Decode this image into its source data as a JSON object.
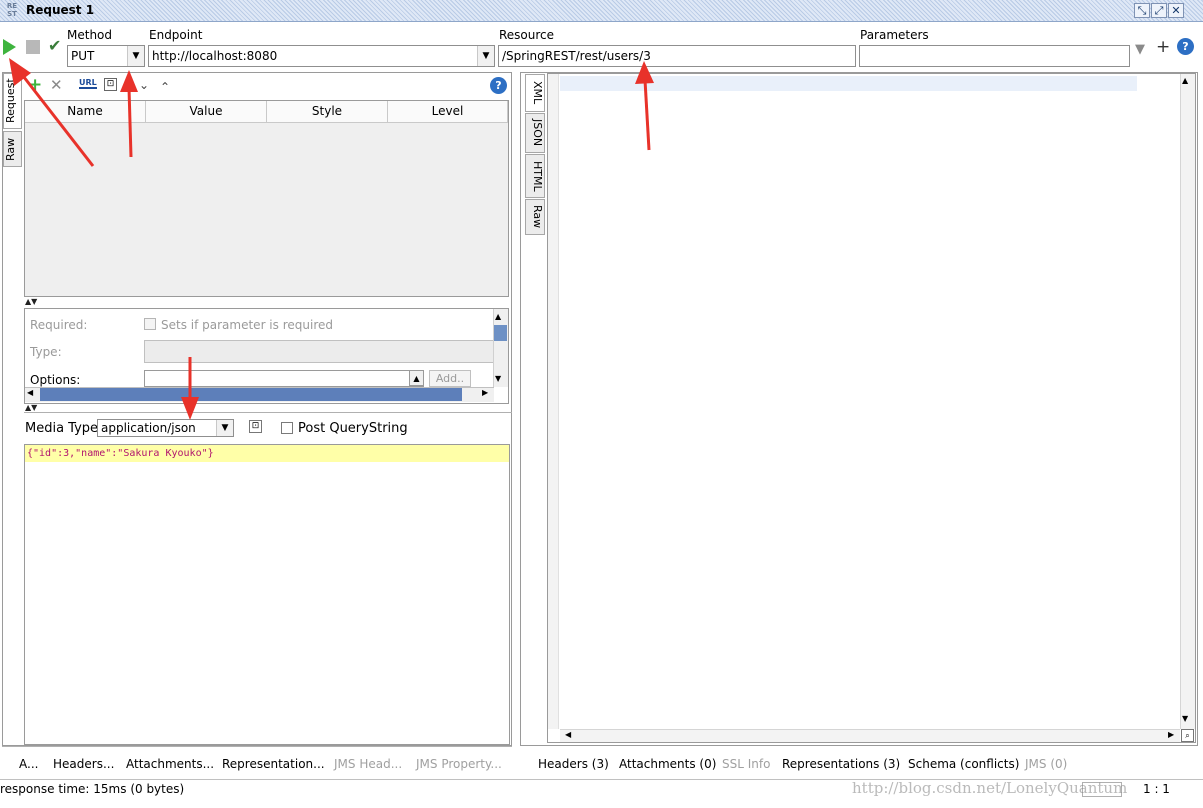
{
  "window": {
    "title": "Request 1",
    "logo_text": "RE ST"
  },
  "toolbar": {
    "method_label": "Method",
    "method_value": "PUT",
    "endpoint_label": "Endpoint",
    "endpoint_value": "http://localhost:8080",
    "resource_label": "Resource",
    "resource_value": "/SpringREST/rest/users/3",
    "parameters_label": "Parameters",
    "parameters_value": ""
  },
  "left_tabs": [
    "Request",
    "Raw"
  ],
  "right_tabs": [
    "XML",
    "JSON",
    "HTML",
    "Raw"
  ],
  "params_table": {
    "columns": [
      "Name",
      "Value",
      "Style",
      "Level"
    ]
  },
  "param_details": {
    "required_label": "Required:",
    "required_checkbox_label": "Sets if parameter is required",
    "type_label": "Type:",
    "options_label": "Options:",
    "add_button": "Add.."
  },
  "media": {
    "label": "Media Type",
    "value": "application/json",
    "post_querystring_label": "Post QueryString"
  },
  "body_content": "{\"id\":3,\"name\":\"Sakura Kyouko\"}",
  "bottom_tabs_left": [
    {
      "label": "A...",
      "enabled": true
    },
    {
      "label": "Headers...",
      "enabled": true
    },
    {
      "label": "Attachments...",
      "enabled": true
    },
    {
      "label": "Representation...",
      "enabled": true
    },
    {
      "label": "JMS Head...",
      "enabled": false
    },
    {
      "label": "JMS Property...",
      "enabled": false
    }
  ],
  "bottom_tabs_right": [
    {
      "label": "Headers (3)",
      "enabled": true
    },
    {
      "label": "Attachments (0)",
      "enabled": true
    },
    {
      "label": "SSL Info",
      "enabled": false
    },
    {
      "label": "Representations (3)",
      "enabled": true
    },
    {
      "label": "Schema (conflicts)",
      "enabled": true
    },
    {
      "label": "JMS (0)",
      "enabled": false
    }
  ],
  "status": {
    "response_time": "response time: 15ms (0 bytes)",
    "cursor_pos": "1 : 1"
  },
  "watermark": "http://blog.csdn.net/LonelyQuantum",
  "colors": {
    "accent": "#2d6fc4",
    "arrow": "#e8322a",
    "body_highlight": "#ffffa8"
  }
}
